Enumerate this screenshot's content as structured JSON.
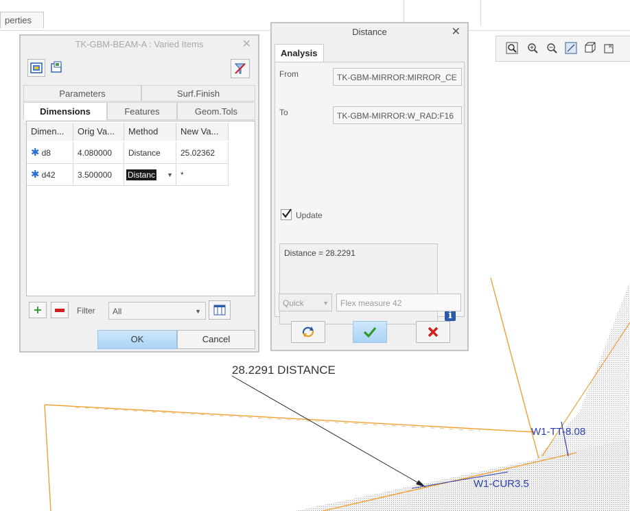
{
  "topbar": {
    "properties_tab": "perties"
  },
  "varied_dialog": {
    "title": "TK-GBM-BEAM-A : Varied Items",
    "tabs_row1": [
      "Parameters",
      "Surf.Finish"
    ],
    "tabs_row2": [
      "Dimensions",
      "Features",
      "Geom.Tols"
    ],
    "columns": [
      "Dimen...",
      "Orig Va...",
      "Method",
      "New Va..."
    ],
    "rows": [
      {
        "name": "d8",
        "orig": "4.080000",
        "method": "Distance",
        "new": "25.02362"
      },
      {
        "name": "d42",
        "orig": "3.500000",
        "method": "Distanc",
        "new": "*"
      }
    ],
    "filter_label": "Filter",
    "filter_value": "All",
    "ok": "OK",
    "cancel": "Cancel"
  },
  "distance_dialog": {
    "title": "Distance",
    "tab": "Analysis",
    "from_label": "From",
    "from_value": "TK-GBM-MIRROR:MIRROR_CE",
    "to_label": "To",
    "to_value": "TK-GBM-MIRROR:W_RAD:F16",
    "update_label": "Update",
    "update_checked": true,
    "result": "Distance = 28.2291",
    "quick_label": "Quick",
    "measure_name": "Flex measure 42"
  },
  "graphics": {
    "distance_annotation": "28.2291  DISTANCE",
    "label_top": "W1-TT-",
    "label_top_value": "8.08",
    "label_bottom": "W1-CUR",
    "label_bottom_value": "3.5",
    "accent_orange": "#f0a030",
    "accent_blue": "#2a3fb0"
  }
}
